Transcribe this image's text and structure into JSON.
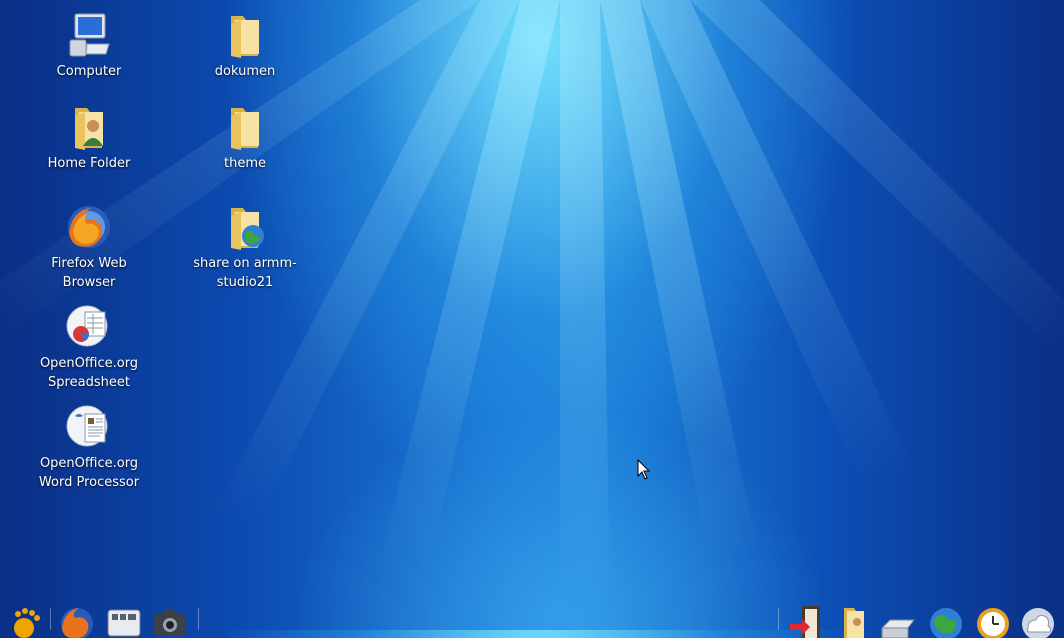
{
  "desktop": {
    "icons": [
      {
        "label": "Computer",
        "icon": "computer-icon"
      },
      {
        "label": "dokumen",
        "icon": "folder-icon"
      },
      {
        "label": "Home Folder",
        "icon": "home-folder-icon"
      },
      {
        "label": "theme",
        "icon": "folder-icon"
      },
      {
        "label": "Firefox Web Browser",
        "icon": "firefox-icon"
      },
      {
        "label": "share on armm-studio21",
        "icon": "network-share-icon"
      },
      {
        "label": "OpenOffice.org Spreadsheet",
        "icon": "spreadsheet-icon"
      },
      {
        "label": "OpenOffice.org Word Processor",
        "icon": "word-processor-icon"
      }
    ]
  },
  "panel": {
    "left_launchers": [
      "gnome-menu-icon",
      "firefox-icon",
      "keyboard-icon",
      "camera-icon"
    ],
    "right_tray": [
      "logout-icon",
      "home-folder-icon",
      "scanner-icon",
      "globe-icon",
      "clock-icon",
      "weather-icon"
    ]
  },
  "colors": {
    "accent": "#1d82da",
    "dark": "#0a2f86"
  }
}
